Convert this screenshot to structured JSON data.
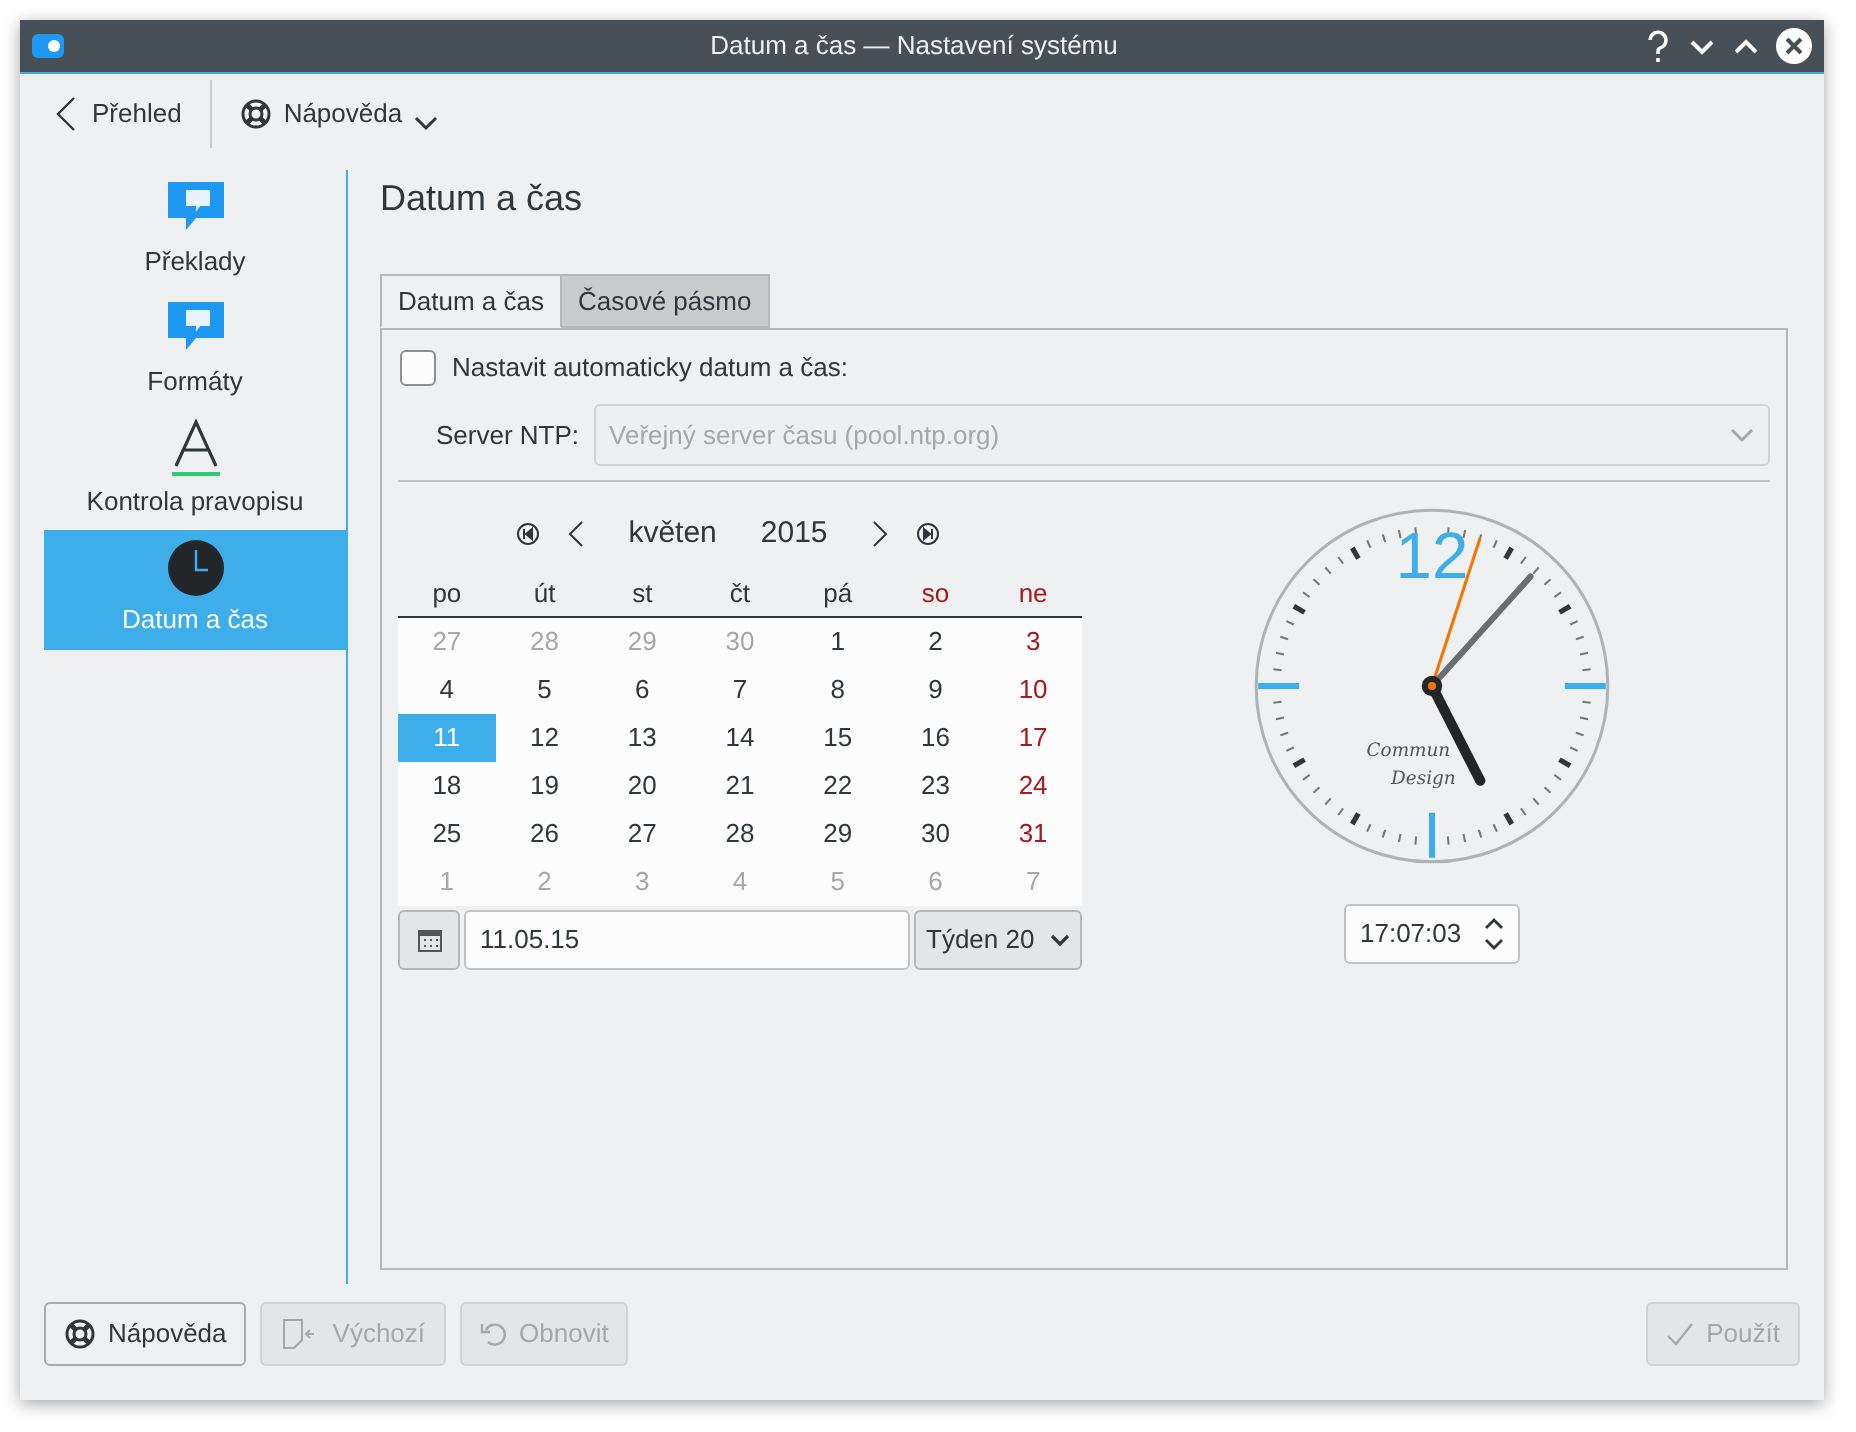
{
  "window": {
    "title": "Datum a čas  — Nastavení systému"
  },
  "toolbar": {
    "back": "Přehled",
    "help": "Nápověda"
  },
  "sidebar": {
    "items": [
      {
        "label": "Překlady",
        "kind": "speech",
        "selected": false
      },
      {
        "label": "Formáty",
        "kind": "speech",
        "selected": false
      },
      {
        "label": "Kontrola pravopisu",
        "kind": "letter",
        "selected": false
      },
      {
        "label": "Datum a čas",
        "kind": "clock",
        "selected": true
      }
    ]
  },
  "page_title": "Datum a čas",
  "tabs": [
    {
      "label": "Datum a čas",
      "selected": true
    },
    {
      "label": "Časové pásmo",
      "selected": false
    }
  ],
  "auto_set": {
    "label": "Nastavit automaticky datum a čas:",
    "checked": false
  },
  "ntp": {
    "label": "Server NTP:",
    "value": "Veřejný server času (pool.ntp.org)",
    "disabled": true
  },
  "calendar": {
    "month": "květen",
    "year": "2015",
    "weekdays": [
      {
        "text": "po",
        "weekend": false
      },
      {
        "text": "út",
        "weekend": false
      },
      {
        "text": "st",
        "weekend": false
      },
      {
        "text": "čt",
        "weekend": false
      },
      {
        "text": "pá",
        "weekend": false
      },
      {
        "text": "so",
        "weekend": true
      },
      {
        "text": "ne",
        "weekend": true
      }
    ],
    "weeks": [
      [
        {
          "text": "27",
          "kind": "outside",
          "selected": false
        },
        {
          "text": "28",
          "kind": "outside",
          "selected": false
        },
        {
          "text": "29",
          "kind": "outside",
          "selected": false
        },
        {
          "text": "30",
          "kind": "outside",
          "selected": false
        },
        {
          "text": "1",
          "kind": "day",
          "selected": false
        },
        {
          "text": "2",
          "kind": "day",
          "selected": false
        },
        {
          "text": "3",
          "kind": "sunday",
          "selected": false
        }
      ],
      [
        {
          "text": "4",
          "kind": "day",
          "selected": false
        },
        {
          "text": "5",
          "kind": "day",
          "selected": false
        },
        {
          "text": "6",
          "kind": "day",
          "selected": false
        },
        {
          "text": "7",
          "kind": "day",
          "selected": false
        },
        {
          "text": "8",
          "kind": "day",
          "selected": false
        },
        {
          "text": "9",
          "kind": "day",
          "selected": false
        },
        {
          "text": "10",
          "kind": "sunday",
          "selected": false
        }
      ],
      [
        {
          "text": "11",
          "kind": "day",
          "selected": true
        },
        {
          "text": "12",
          "kind": "day",
          "selected": false
        },
        {
          "text": "13",
          "kind": "day",
          "selected": false
        },
        {
          "text": "14",
          "kind": "day",
          "selected": false
        },
        {
          "text": "15",
          "kind": "day",
          "selected": false
        },
        {
          "text": "16",
          "kind": "day",
          "selected": false
        },
        {
          "text": "17",
          "kind": "sunday",
          "selected": false
        }
      ],
      [
        {
          "text": "18",
          "kind": "day",
          "selected": false
        },
        {
          "text": "19",
          "kind": "day",
          "selected": false
        },
        {
          "text": "20",
          "kind": "day",
          "selected": false
        },
        {
          "text": "21",
          "kind": "day",
          "selected": false
        },
        {
          "text": "22",
          "kind": "day",
          "selected": false
        },
        {
          "text": "23",
          "kind": "day",
          "selected": false
        },
        {
          "text": "24",
          "kind": "sunday",
          "selected": false
        }
      ],
      [
        {
          "text": "25",
          "kind": "day",
          "selected": false
        },
        {
          "text": "26",
          "kind": "day",
          "selected": false
        },
        {
          "text": "27",
          "kind": "day",
          "selected": false
        },
        {
          "text": "28",
          "kind": "day",
          "selected": false
        },
        {
          "text": "29",
          "kind": "day",
          "selected": false
        },
        {
          "text": "30",
          "kind": "day",
          "selected": false
        },
        {
          "text": "31",
          "kind": "sunday",
          "selected": false
        }
      ],
      [
        {
          "text": "1",
          "kind": "outside",
          "selected": false
        },
        {
          "text": "2",
          "kind": "outside",
          "selected": false
        },
        {
          "text": "3",
          "kind": "outside",
          "selected": false
        },
        {
          "text": "4",
          "kind": "outside",
          "selected": false
        },
        {
          "text": "5",
          "kind": "outside",
          "selected": false
        },
        {
          "text": "6",
          "kind": "outside",
          "selected": false
        },
        {
          "text": "7",
          "kind": "outside",
          "selected": false
        }
      ]
    ],
    "date_value": "11.05.15",
    "week": "Týden 20"
  },
  "clock": {
    "numeral": "12",
    "brand": [
      "Commun",
      "Design"
    ],
    "time": "17:07:03"
  },
  "buttons": [
    {
      "label": "Nápověda",
      "kind": "help",
      "disabled": false
    },
    {
      "label": "Výchozí",
      "kind": "defaults",
      "disabled": true
    },
    {
      "label": "Obnovit",
      "kind": "reset",
      "disabled": true
    },
    {
      "label": "Použít",
      "kind": "apply",
      "disabled": true
    }
  ]
}
